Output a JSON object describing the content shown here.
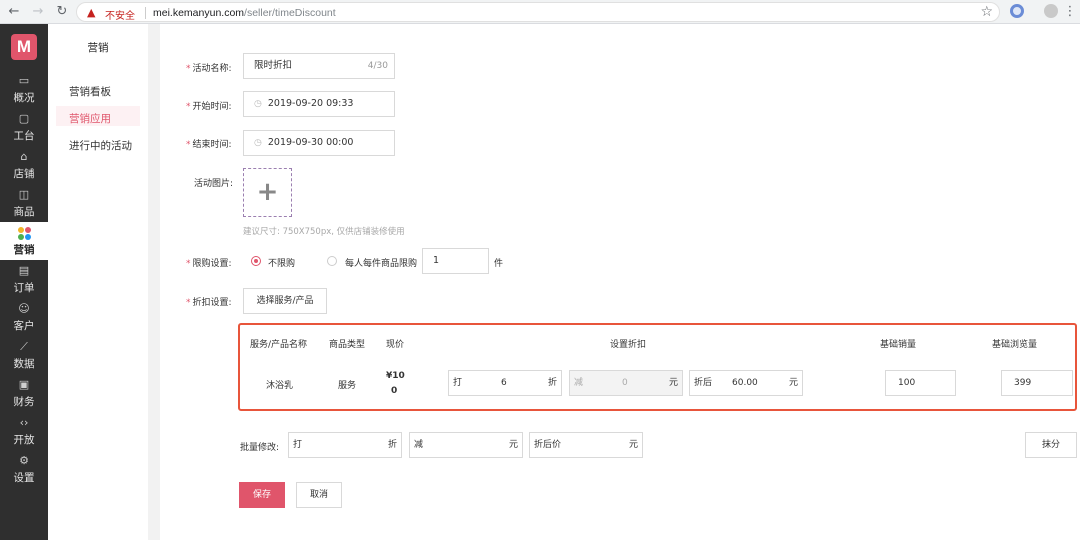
{
  "browser": {
    "insecure_label": "不安全",
    "url_host": "mei.kemanyun.com",
    "url_path": "/seller/timeDiscount"
  },
  "appnav": {
    "logo": "M",
    "items": [
      {
        "label": "概况",
        "icon": "monitor-icon"
      },
      {
        "label": "工台",
        "icon": "desktop-icon"
      },
      {
        "label": "店铺",
        "icon": "store-icon"
      },
      {
        "label": "商品",
        "icon": "bag-icon"
      },
      {
        "label": "营销",
        "icon": "marketing-dots-icon",
        "active": true
      },
      {
        "label": "订单",
        "icon": "order-icon"
      },
      {
        "label": "客户",
        "icon": "user-icon"
      },
      {
        "label": "数据",
        "icon": "chart-icon"
      },
      {
        "label": "财务",
        "icon": "finance-icon"
      },
      {
        "label": "开放",
        "icon": "code-icon"
      },
      {
        "label": "设置",
        "icon": "gear-icon"
      }
    ]
  },
  "submenu": {
    "title": "营销",
    "items": [
      "营销看板",
      "营销应用",
      "进行中的活动"
    ],
    "active_index": 1
  },
  "form": {
    "activity_name": {
      "label": "活动名称:",
      "value": "限时折扣",
      "count": "4/30"
    },
    "start_time": {
      "label": "开始时间:",
      "value": "2019-09-20 09:33"
    },
    "end_time": {
      "label": "结束时间:",
      "value": "2019-09-30 00:00"
    },
    "image": {
      "label": "活动图片:",
      "hint": "建议尺寸: 750X750px, 仅供店铺装修使用"
    },
    "limit": {
      "label": "限购设置:",
      "option_unlimited": "不限购",
      "option_limited": "每人每件商品限购",
      "limit_value": "1",
      "unit": "件",
      "selected": "unlimited"
    },
    "discount": {
      "label": "折扣设置:",
      "select_button": "选择服务/产品"
    }
  },
  "table": {
    "headers": [
      "服务/产品名称",
      "商品类型",
      "现价",
      "设置折扣",
      "基础销量",
      "基础浏览量"
    ],
    "rows": [
      {
        "name": "沐浴乳",
        "type": "服务",
        "price_line1": "¥10",
        "price_line2": "0",
        "discount_prefix": "打",
        "discount_value": "6",
        "discount_suffix": "折",
        "minus_prefix": "减",
        "minus_value": "0",
        "minus_suffix": "元",
        "after_prefix": "折后",
        "after_value": "60.00",
        "after_suffix": "元",
        "base_sales": "100",
        "base_views": "399"
      }
    ]
  },
  "batch": {
    "label": "批量修改:",
    "discount_prefix": "打",
    "discount_suffix": "折",
    "minus_prefix": "减",
    "minus_suffix": "元",
    "after_prefix": "折后价",
    "after_suffix": "元",
    "round_button": "抹分"
  },
  "actions": {
    "save": "保存",
    "cancel": "取消"
  },
  "colors": {
    "accent": "#e0556b",
    "highlight_border": "#e8553b"
  }
}
